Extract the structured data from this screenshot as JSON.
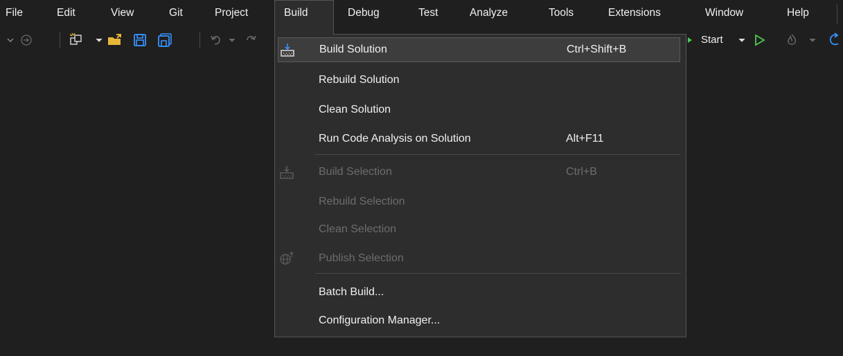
{
  "menubar": {
    "items": [
      {
        "label": "File"
      },
      {
        "label": "Edit"
      },
      {
        "label": "View"
      },
      {
        "label": "Git"
      },
      {
        "label": "Project"
      },
      {
        "label": "Build"
      },
      {
        "label": "Debug"
      },
      {
        "label": "Test"
      },
      {
        "label": "Analyze"
      },
      {
        "label": "Tools"
      },
      {
        "label": "Extensions"
      },
      {
        "label": "Window"
      },
      {
        "label": "Help"
      }
    ],
    "active_index": 5
  },
  "toolbar": {
    "start_label": "Start",
    "icons": [
      "nav-back-icon",
      "nav-forward-icon",
      "new-project-icon",
      "open-folder-icon",
      "save-icon",
      "save-all-icon",
      "undo-icon",
      "redo-icon",
      "start-debug-icon",
      "start-without-debug-icon",
      "hot-reload-icon",
      "restart-icon"
    ]
  },
  "build_menu": {
    "items": [
      {
        "label": "Build Solution",
        "shortcut": "Ctrl+Shift+B",
        "enabled": true,
        "highlighted": true,
        "icon": "build-icon"
      },
      {
        "label": "Rebuild Solution",
        "shortcut": "",
        "enabled": true
      },
      {
        "label": "Clean Solution",
        "shortcut": "",
        "enabled": true
      },
      {
        "label": "Run Code Analysis on Solution",
        "shortcut": "Alt+F11",
        "enabled": true
      },
      {
        "label": "Build Selection",
        "shortcut": "Ctrl+B",
        "enabled": false,
        "icon": "build-icon"
      },
      {
        "label": "Rebuild Selection",
        "shortcut": "",
        "enabled": false
      },
      {
        "label": "Clean Selection",
        "shortcut": "",
        "enabled": false
      },
      {
        "label": "Publish Selection",
        "shortcut": "",
        "enabled": false,
        "icon": "publish-icon"
      },
      {
        "label": "Batch Build...",
        "shortcut": "",
        "enabled": true
      },
      {
        "label": "Configuration Manager...",
        "shortcut": "",
        "enabled": true
      }
    ]
  },
  "colors": {
    "background": "#1f1f1f",
    "menu_background": "#2d2d2d",
    "menu_border": "#555555",
    "highlight": "#3d3d3d",
    "text": "#f1f1f1",
    "disabled_text": "#6d6d6d",
    "accent_green": "#4ec94e",
    "accent_yellow": "#e8b73a",
    "accent_blue": "#3794ff"
  }
}
